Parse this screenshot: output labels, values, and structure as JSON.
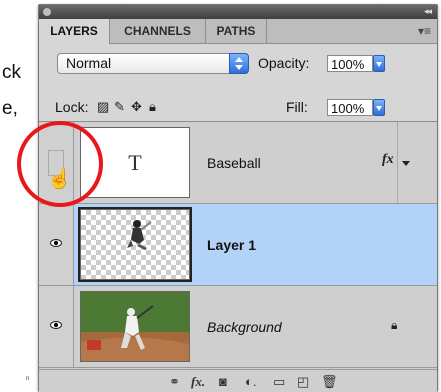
{
  "background_text": {
    "line1": "ck",
    "line2": "e,",
    "tiny": "n"
  },
  "tabs": [
    {
      "label": "LAYERS",
      "active": true
    },
    {
      "label": "CHANNELS",
      "active": false
    },
    {
      "label": "PATHS",
      "active": false
    }
  ],
  "panel_menu_icon": "panel-menu-icon",
  "blend_mode": {
    "value": "Normal"
  },
  "opacity": {
    "label": "Opacity:",
    "value": "100%"
  },
  "lock": {
    "label": "Lock:"
  },
  "fill": {
    "label": "Fill:",
    "value": "100%"
  },
  "layers": [
    {
      "name": "Baseball",
      "type": "text",
      "thumb_glyph": "T",
      "visible": false,
      "has_fx": true,
      "fx_label": "fx",
      "selected": false
    },
    {
      "name": "Layer 1",
      "type": "pixel",
      "visible": true,
      "selected": true
    },
    {
      "name": "Background",
      "type": "photo",
      "visible": true,
      "locked": true,
      "selected": false
    }
  ],
  "bottom_icons": [
    "link-icon",
    "fx-icon",
    "mask-icon",
    "adjustment-icon",
    "group-icon",
    "new-layer-icon",
    "trash-icon"
  ],
  "colors": {
    "selected_row": "#b3d2f8",
    "highlight": "#e8171b",
    "accent": "#2b6fd6"
  }
}
